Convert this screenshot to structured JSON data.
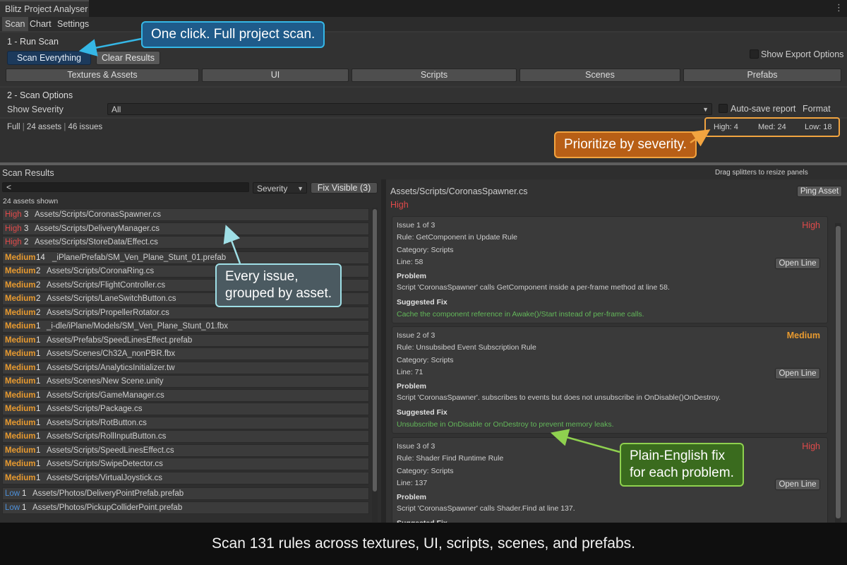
{
  "window": {
    "title": "Blitz Project Analyser",
    "menu_icon": "more-vertical-icon"
  },
  "tabs": [
    "Scan",
    "Chart",
    "Settings"
  ],
  "run_scan": {
    "title": "1 - Run Scan",
    "scan_everything": "Scan Everything",
    "clear_results": "Clear Results",
    "show_export_options": "Show Export Options",
    "categories": [
      "Textures & Assets",
      "UI",
      "Scripts",
      "Scenes",
      "Prefabs"
    ]
  },
  "scan_options": {
    "title": "2 - Scan Options",
    "show_severity_label": "Show Severity",
    "show_severity_value": "All",
    "auto_save": "Auto-save report",
    "format": "Format"
  },
  "status": {
    "mode": "Full",
    "assets": "24 assets",
    "issues": "46 issues",
    "high": "High: 4",
    "med": "Med: 24",
    "low": "Low: 18"
  },
  "results": {
    "title": "Scan Results",
    "hint": "Drag splitters to resize panels",
    "search_value": "<",
    "sort_value": "Severity",
    "fix_visible": "Fix Visible (3)",
    "assets_shown": "24 assets shown",
    "rows": [
      {
        "sev": "High",
        "count": "3",
        "path": "Assets/Scripts/CoronasSpawner.cs"
      },
      {
        "sev": "High",
        "count": "3",
        "path": "Assets/Scripts/DeliveryManager.cs"
      },
      {
        "sev": "High",
        "count": "2",
        "path": "Assets/Scripts/StoreData/Effect.cs"
      },
      {
        "sev": "Medium",
        "count": "14",
        "path": "_iPlane/Prefab/SM_Ven_Plane_Stunt_01.prefab"
      },
      {
        "sev": "Medium",
        "count": "2",
        "path": "Assets/Scripts/CoronaRing.cs"
      },
      {
        "sev": "Medium",
        "count": "2",
        "path": "Assets/Scripts/FlightController.cs"
      },
      {
        "sev": "Medium",
        "count": "2",
        "path": "Assets/Scripts/LaneSwitchButton.cs"
      },
      {
        "sev": "Medium",
        "count": "2",
        "path": "Assets/Scripts/PropellerRotator.cs"
      },
      {
        "sev": "Medium",
        "count": "1",
        "path": "_i-dle/iPlane/Models/SM_Ven_Plane_Stunt_01.fbx"
      },
      {
        "sev": "Medium",
        "count": "1",
        "path": "Assets/Prefabs/SpeedLinesEffect.prefab"
      },
      {
        "sev": "Medium",
        "count": "1",
        "path": "Assets/Scenes/Ch32A_nonPBR.fbx"
      },
      {
        "sev": "Medium",
        "count": "1",
        "path": "Assets/Scripts/AnalyticsInitializer.tw"
      },
      {
        "sev": "Medium",
        "count": "1",
        "path": "Assets/Scenes/New Scene.unity"
      },
      {
        "sev": "Medium",
        "count": "1",
        "path": "Assets/Scripts/GameManager.cs"
      },
      {
        "sev": "Medium",
        "count": "1",
        "path": "Assets/Scripts/Package.cs"
      },
      {
        "sev": "Medium",
        "count": "1",
        "path": "Assets/Scripts/RotButton.cs"
      },
      {
        "sev": "Medium",
        "count": "1",
        "path": "Assets/Scripts/RollInputButton.cs"
      },
      {
        "sev": "Medium",
        "count": "1",
        "path": "Assets/Scripts/SpeedLinesEffect.cs"
      },
      {
        "sev": "Medium",
        "count": "1",
        "path": "Assets/Scripts/SwipeDetector.cs"
      },
      {
        "sev": "Medium",
        "count": "1",
        "path": "Assets/Scripts/VirtualJoystick.cs"
      },
      {
        "sev": "Low",
        "count": "1",
        "path": "Assets/Photos/DeliveryPointPrefab.prefab"
      },
      {
        "sev": "Low",
        "count": "1",
        "path": "Assets/Photos/PickupColliderPoint.prefab"
      }
    ]
  },
  "detail": {
    "path": "Assets/Scripts/CoronasSpawner.cs",
    "severity": "High",
    "ping_asset": "Ping Asset",
    "open_line": "Open Line",
    "issues": [
      {
        "header": "Issue 1 of 3",
        "sev": "High",
        "rule": "Rule: GetComponent in Update Rule",
        "category": "Category: Scripts",
        "line": "Line: 58",
        "problem_label": "Problem",
        "problem": "Script 'CoronasSpawner' calls GetComponent inside a per-frame method at line 58.",
        "fix_label": "Suggested Fix",
        "fix": "Cache the component reference in Awake()/Start instead of per-frame calls."
      },
      {
        "header": "Issue 2 of 3",
        "sev": "Medium",
        "rule": "Rule: Unsubsibed Event Subscription Rule",
        "category": "Category: Scripts",
        "line": "Line: 71",
        "problem_label": "Problem",
        "problem": "Script 'CoronasSpawner'. subscribes to events but does not unsubscribe in OnDisable()OnDestroy.",
        "fix_label": "Suggested Fix",
        "fix": "Unsubscribe in OnDisable or OnDestroy to prevent memory leaks."
      },
      {
        "header": "Issue 3 of 3",
        "sev": "High",
        "rule": "Rule: Shader Find Runtime Rule",
        "category": "Category: Scripts",
        "line": "Line: 137",
        "problem_label": "Problem",
        "problem": "Script 'CoronasSpawner' calls Shader.Find at line 137.",
        "fix_label": "Suggested Fix",
        "fix": ""
      }
    ]
  },
  "callouts": {
    "one_click": "One click. Full project scan.",
    "prioritize": "Prioritize by severity.",
    "every_issue_1": "Every issue,",
    "every_issue_2": "grouped by asset.",
    "plain_fix_1": "Plain-English fix",
    "plain_fix_2": "for each problem."
  },
  "caption": "Scan 131 rules across textures, UI, scripts, scenes, and prefabs.",
  "colors": {
    "high": "#e04a4a",
    "medium": "#e89a2f",
    "low": "#4d8fd8",
    "fix": "#63b85a"
  }
}
